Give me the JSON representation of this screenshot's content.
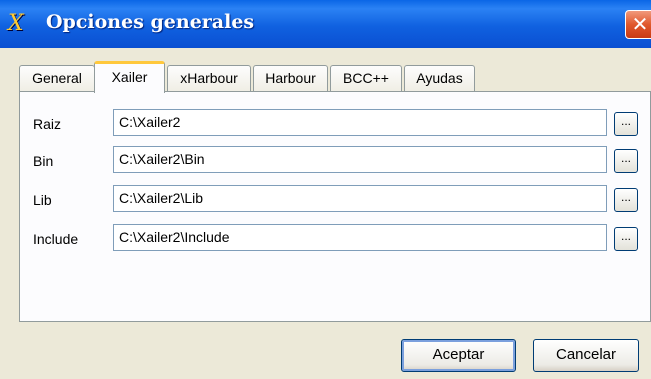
{
  "window": {
    "title": "Opciones generales",
    "app_icon_text": "X",
    "close_label": "✕"
  },
  "tabs": [
    {
      "label": "General"
    },
    {
      "label": "Xailer",
      "active": true
    },
    {
      "label": "xHarbour"
    },
    {
      "label": "Harbour"
    },
    {
      "label": "BCC++"
    },
    {
      "label": "Ayudas"
    }
  ],
  "paths": [
    {
      "label": "Raiz",
      "value": "C:\\Xailer2"
    },
    {
      "label": "Bin",
      "value": "C:\\Xailer2\\Bin"
    },
    {
      "label": "Lib",
      "value": "C:\\Xailer2\\Lib"
    },
    {
      "label": "Include",
      "value": "C:\\Xailer2\\Include"
    }
  ],
  "browse_label": "...",
  "buttons": {
    "accept": "Aceptar",
    "cancel": "Cancelar"
  }
}
